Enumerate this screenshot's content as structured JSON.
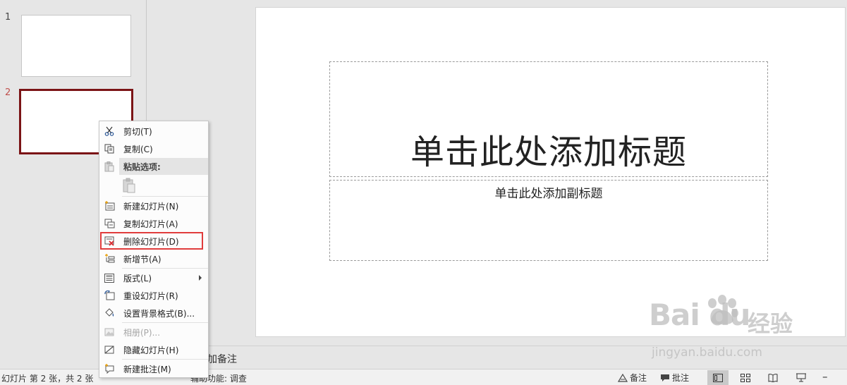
{
  "thumbnails": {
    "items": [
      {
        "number": "1"
      },
      {
        "number": "2"
      }
    ]
  },
  "slide": {
    "title_placeholder": "单击此处添加标题",
    "subtitle_placeholder": "单击此处添加副标题"
  },
  "notes": {
    "text": "加备注"
  },
  "status_bar": {
    "slide_info": "幻灯片 第 2 张，共 2 张",
    "accessibility": "辅助功能: 调查",
    "notes_label": "备注",
    "comments_label": "批注",
    "zoom_out": "–"
  },
  "context_menu": {
    "items": {
      "cut": "剪切(T)",
      "copy": "复制(C)",
      "paste_options": "粘贴选项:",
      "new_slide": "新建幻灯片(N)",
      "duplicate_slide": "复制幻灯片(A)",
      "delete_slide": "删除幻灯片(D)",
      "add_section": "新增节(A)",
      "layout": "版式(L)",
      "reset_slide": "重设幻灯片(R)",
      "format_background": "设置背景格式(B)...",
      "photo_album": "相册(P)...",
      "hide_slide": "隐藏幻灯片(H)",
      "new_comment": "新建批注(M)"
    }
  },
  "watermark": {
    "logo": "Bai du",
    "cn": "经验",
    "url": "jingyan.baidu.com"
  },
  "colors": {
    "selected_thumb_border": "#7b1416",
    "active_number": "#c0504d",
    "highlight": "#e03c3c"
  }
}
